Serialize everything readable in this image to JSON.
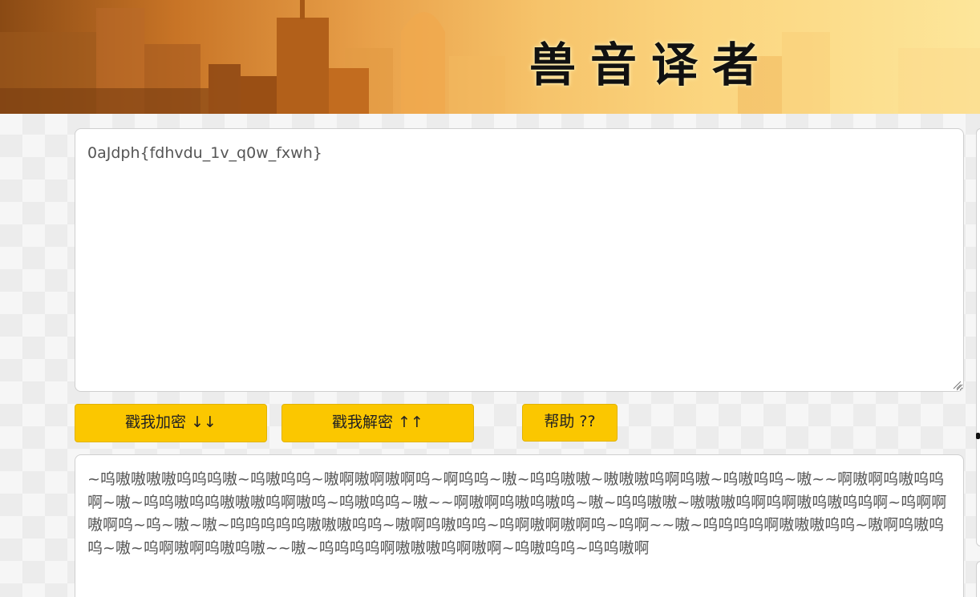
{
  "header": {
    "title": "兽音译者"
  },
  "plain_text": {
    "value": "0aJdph{fdhvdu_1v_q0w_fxwh}"
  },
  "buttons": {
    "encrypt_label": "戳我加密 ↓↓",
    "decrypt_label": "戳我解密 ↑↑",
    "help_label": "帮助 ??"
  },
  "cipher_text": {
    "value": "~呜嗷嗷嗷嗷呜呜呜嗷~呜嗷呜呜~嗷啊嗷啊嗷啊呜~啊呜呜~嗷~呜呜嗷嗷~嗷嗷嗷呜啊呜嗷~呜嗷呜呜~嗷~~啊嗷啊呜嗷呜呜啊~嗷~呜呜嗷呜呜嗷嗷嗷呜啊嗷呜~呜嗷呜呜~嗷~~啊嗷啊呜嗷呜嗷呜~嗷~呜呜嗷嗷~嗷嗷嗷呜啊呜啊嗷呜嗷呜呜啊~呜啊啊嗷啊呜~呜~嗷~嗷~呜呜呜呜呜嗷嗷嗷呜呜~嗷啊呜嗷呜呜~呜啊嗷啊嗷啊呜~呜啊~~嗷~呜呜呜呜啊嗷嗷嗷呜呜~嗷啊呜嗷呜呜~嗷~呜啊嗷啊呜嗷呜嗷~~嗷~呜呜呜呜啊嗷嗷嗷呜啊嗷啊~呜嗷呜呜~呜呜嗷啊"
  },
  "colors": {
    "button_bg": "#fbc700",
    "banner_light": "#fde69a",
    "banner_dark": "#8a4a14"
  }
}
